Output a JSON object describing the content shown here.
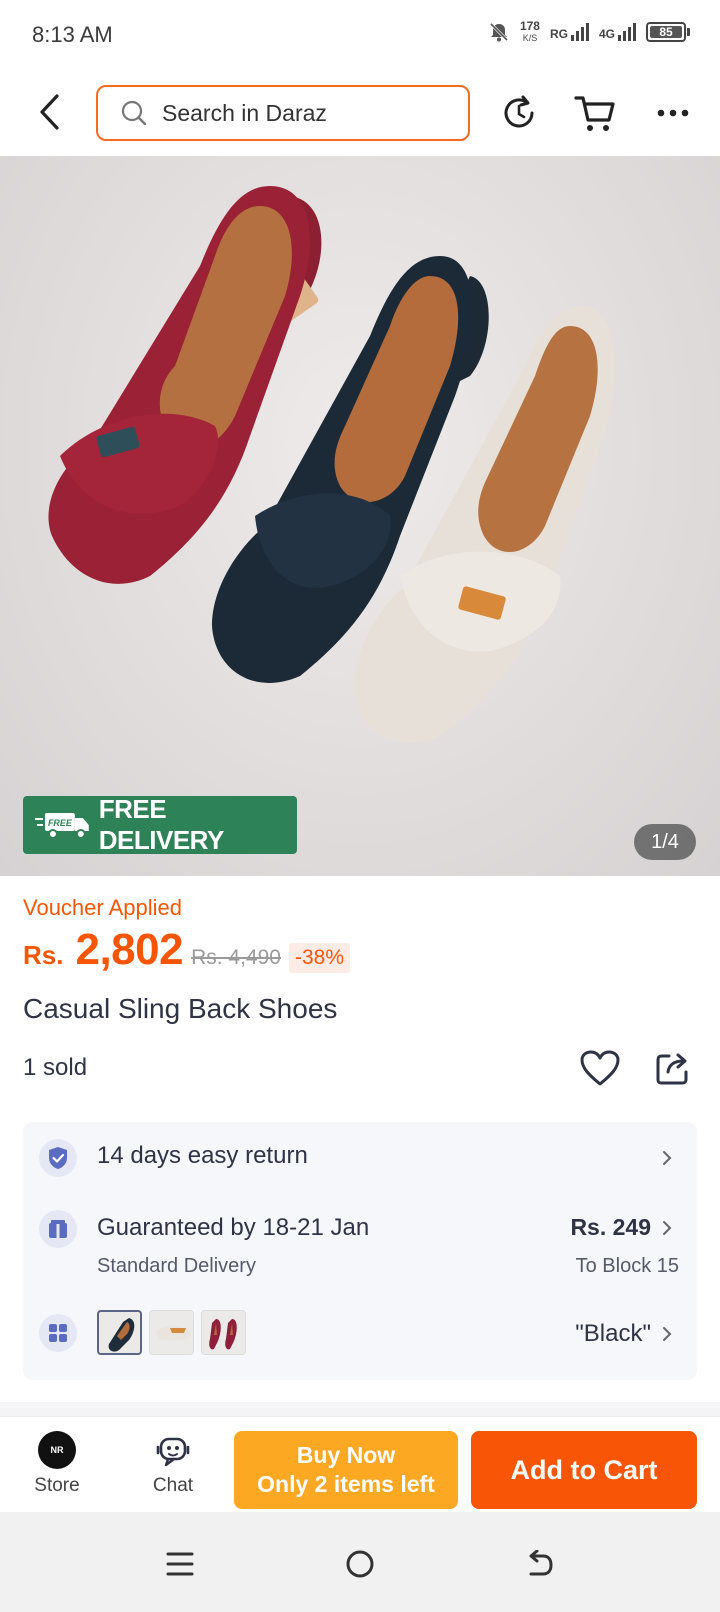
{
  "status_bar": {
    "time": "8:13 AM",
    "net_speed": "178",
    "net_speed_unit": "K/S",
    "carrier_1": "RG",
    "carrier_2": "4G",
    "battery": "85"
  },
  "header": {
    "search_placeholder": "Search in Daraz"
  },
  "gallery": {
    "free_delivery_tag": "FREE",
    "free_delivery_label": "FREE DELIVERY",
    "image_counter": "1/4"
  },
  "product": {
    "voucher_label": "Voucher Applied",
    "currency": "Rs.",
    "price": "2,802",
    "original_price": "Rs. 4,490",
    "discount": "-38%",
    "title": "Casual Sling Back Shoes",
    "sold_count": "1 sold"
  },
  "info": {
    "return_policy": "14 days easy return",
    "delivery_guarantee": "Guaranteed by 18-21 Jan",
    "delivery_type": "Standard Delivery",
    "shipping_price": "Rs. 249",
    "shipping_destination": "To Block 15",
    "selected_variant": "\"Black\"",
    "swatch_colors": [
      "#1f2c3a",
      "#e9e4de",
      "#8f1f3a"
    ]
  },
  "actions": {
    "store_label": "Store",
    "store_logo_text": "NR",
    "chat_label": "Chat",
    "buy_now_label": "Buy Now",
    "buy_now_stock": "Only 2 items left",
    "add_to_cart_label": "Add to Cart"
  },
  "colors": {
    "accent": "#f85606",
    "search_border": "#f36b21",
    "buy_now": "#fca823",
    "free_delivery": "#2e8257"
  }
}
